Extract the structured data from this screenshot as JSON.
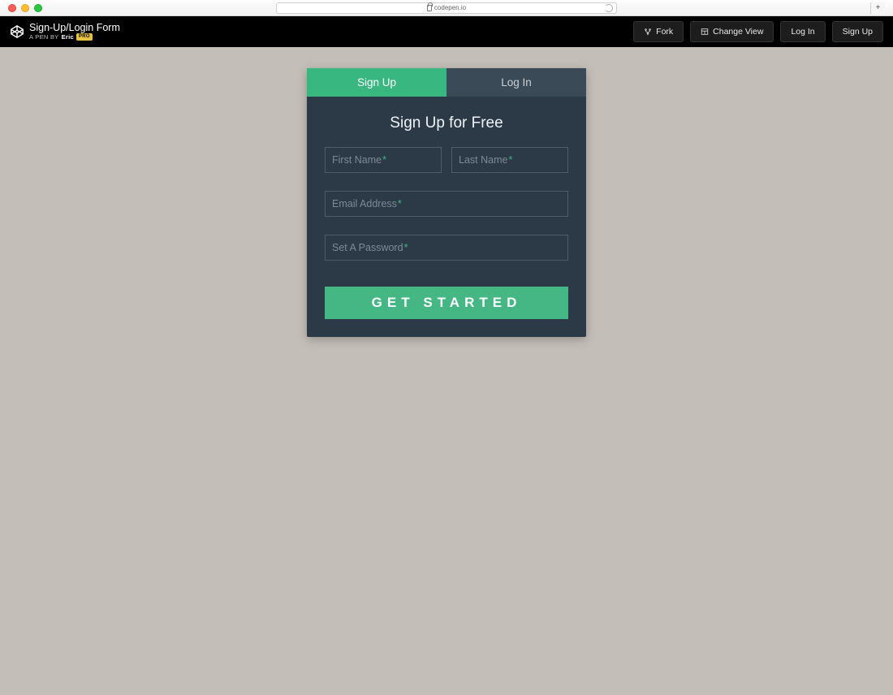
{
  "browser": {
    "url": "codepen.io"
  },
  "header": {
    "title": "Sign-Up/Login Form",
    "subtitle_prefix": "A PEN BY",
    "author": "Eric",
    "pro_badge": "PRO",
    "buttons": {
      "fork": "Fork",
      "change_view": "Change View",
      "log_in": "Log In",
      "sign_up": "Sign Up"
    }
  },
  "form": {
    "tabs": {
      "signup": "Sign Up",
      "login": "Log In"
    },
    "title": "Sign Up for Free",
    "fields": {
      "first_name": "First Name",
      "last_name": "Last Name",
      "email": "Email Address",
      "password": "Set A Password"
    },
    "required_mark": "*",
    "submit": "GET STARTED"
  },
  "colors": {
    "accent": "#38b880",
    "card_bg": "#2c3a47",
    "page_bg": "#c4beb9"
  }
}
